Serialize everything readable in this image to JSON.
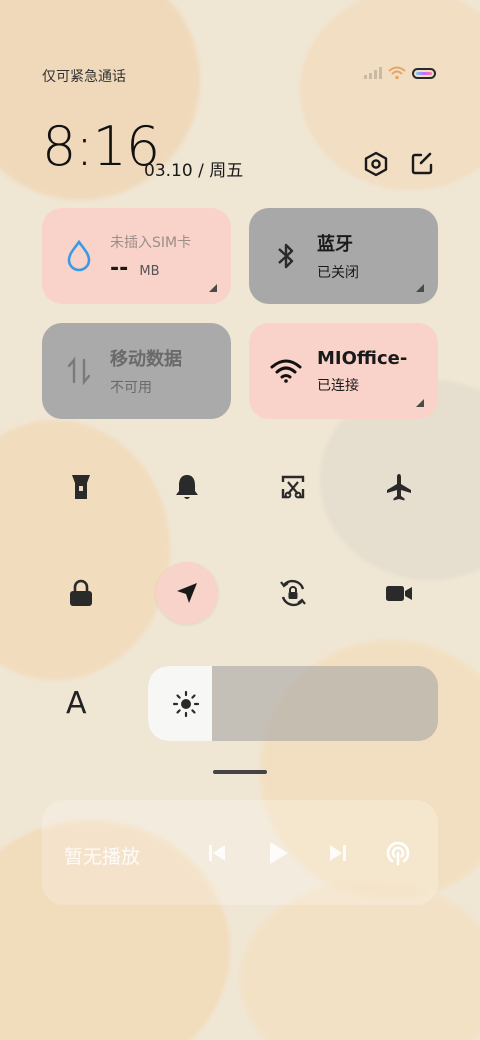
{
  "status_bar": {
    "carrier_text": "仅可紧急通话"
  },
  "header": {
    "time": "8:16",
    "date": "03.10 / 周五"
  },
  "tiles": {
    "data_usage": {
      "title": "未插入SIM卡",
      "value": "--",
      "unit": "MB"
    },
    "bluetooth": {
      "title": "蓝牙",
      "status": "已关闭"
    },
    "mobile_data": {
      "title": "移动数据",
      "status": "不可用"
    },
    "wifi": {
      "title": "MIOffice-",
      "status": "已连接"
    }
  },
  "font_button": {
    "label": "A"
  },
  "brightness": {
    "level": 0.22
  },
  "media": {
    "status": "暂无播放"
  },
  "colors": {
    "tile_active": "#f9d3c9",
    "tile_inactive": "#a8a8a8",
    "water_icon": "#3a9ae6",
    "location_active": "#f8d3c9"
  }
}
